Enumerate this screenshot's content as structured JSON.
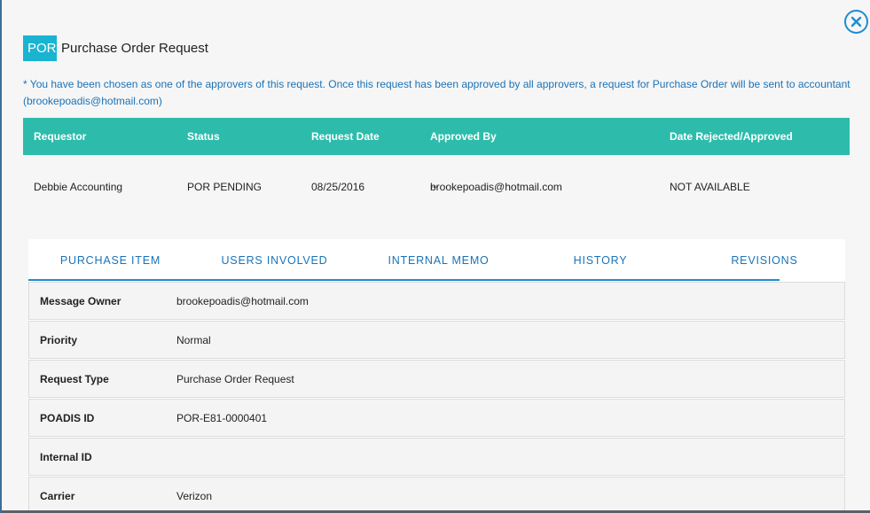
{
  "header": {
    "badge": "POR",
    "title": "Purchase Order Request"
  },
  "notice": "* You have been chosen as one of the approvers of this request. Once this request has been approved by all approvers, a request for Purchase Order will be sent to accountant (brookepoadis@hotmail.com)",
  "summary": {
    "columns": [
      "Requestor",
      "Status",
      "Request Date",
      "Approved By",
      "Date Rejected/Approved"
    ],
    "row": {
      "requestor": "Debbie Accounting",
      "status": "POR PENDING",
      "request_date": "08/25/2016",
      "approved_by": "brookepoadis@hotmail.com",
      "date_rejected_approved": "NOT AVAILABLE"
    }
  },
  "tabs": [
    "PURCHASE ITEM",
    "USERS INVOLVED",
    "INTERNAL MEMO",
    "HISTORY",
    "REVISIONS"
  ],
  "details": [
    {
      "label": "Message Owner",
      "value": "brookepoadis@hotmail.com"
    },
    {
      "label": "Priority",
      "value": "Normal"
    },
    {
      "label": "Request Type",
      "value": "Purchase Order Request"
    },
    {
      "label": "POADIS ID",
      "value": "POR-E81-0000401"
    },
    {
      "label": "Internal ID",
      "value": ""
    },
    {
      "label": "Carrier",
      "value": "Verizon"
    }
  ],
  "icons": {
    "close": "close-circle-icon",
    "more": "more-dots-icon"
  },
  "colors": {
    "accent_teal": "#2dbcab",
    "badge": "#1ab4d1",
    "link_blue": "#1a73b8"
  }
}
